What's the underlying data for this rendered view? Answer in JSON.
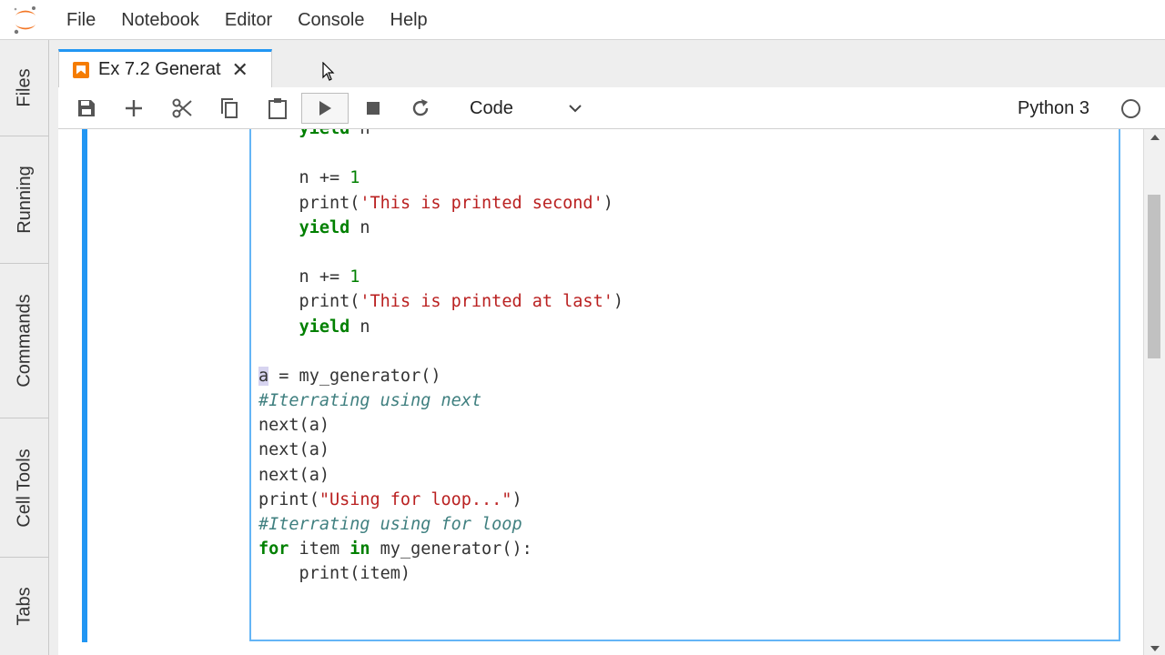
{
  "menu": [
    "File",
    "Notebook",
    "Editor",
    "Console",
    "Help"
  ],
  "sidebar": [
    "Files",
    "Running",
    "Commands",
    "Cell Tools",
    "Tabs"
  ],
  "tab": {
    "title": "Ex 7.2 Generat",
    "close": "✕"
  },
  "toolbar": {
    "cell_type": "Code",
    "kernel": "Python 3",
    "icons": [
      "save-icon",
      "add-icon",
      "cut-icon",
      "copy-icon",
      "paste-icon",
      "run-icon",
      "stop-icon",
      "restart-icon"
    ]
  },
  "code": [
    [
      {
        "t": "    "
      },
      {
        "t": "yield",
        "c": "kw"
      },
      {
        "t": " n"
      }
    ],
    [
      {
        "t": ""
      }
    ],
    [
      {
        "t": "    n += "
      },
      {
        "t": "1",
        "c": "num"
      }
    ],
    [
      {
        "t": "    print("
      },
      {
        "t": "'This is printed second'",
        "c": "str"
      },
      {
        "t": ")"
      }
    ],
    [
      {
        "t": "    "
      },
      {
        "t": "yield",
        "c": "kw"
      },
      {
        "t": " n"
      }
    ],
    [
      {
        "t": ""
      }
    ],
    [
      {
        "t": "    n += "
      },
      {
        "t": "1",
        "c": "num"
      }
    ],
    [
      {
        "t": "    print("
      },
      {
        "t": "'This is printed at last'",
        "c": "str"
      },
      {
        "t": ")"
      }
    ],
    [
      {
        "t": "    "
      },
      {
        "t": "yield",
        "c": "kw"
      },
      {
        "t": " n"
      }
    ],
    [
      {
        "t": ""
      }
    ],
    [
      {
        "t": "a",
        "c": "sel"
      },
      {
        "t": " = my_generator()"
      }
    ],
    [
      {
        "t": "#Iterrating using next",
        "c": "cm"
      }
    ],
    [
      {
        "t": "next(a)"
      }
    ],
    [
      {
        "t": "next(a)"
      }
    ],
    [
      {
        "t": "next(a)"
      }
    ],
    [
      {
        "t": "print("
      },
      {
        "t": "\"Using for loop...\"",
        "c": "str"
      },
      {
        "t": ")"
      }
    ],
    [
      {
        "t": "#Iterrating using for loop",
        "c": "cm"
      }
    ],
    [
      {
        "t": "for",
        "c": "kw"
      },
      {
        "t": " item "
      },
      {
        "t": "in",
        "c": "kw"
      },
      {
        "t": " my_generator():"
      }
    ],
    [
      {
        "t": "    print(item)"
      }
    ]
  ],
  "colors": {
    "accent": "#2196f3",
    "editor_border": "#64b5f6",
    "notebook_icon": "#f57c00"
  }
}
